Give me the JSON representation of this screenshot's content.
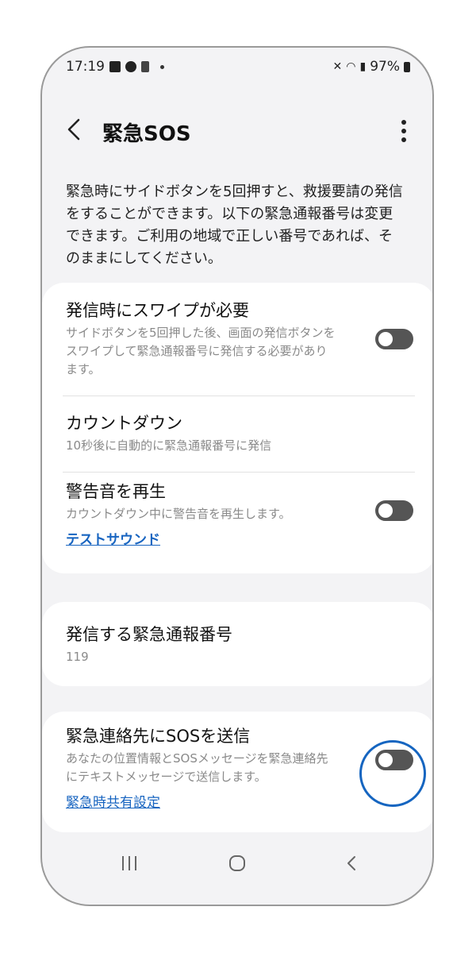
{
  "status_bar": {
    "time": "17:19",
    "battery": "97%",
    "icons": [
      "picture-icon",
      "messenger-icon",
      "notification-icon",
      "dot-icon",
      "mute-icon",
      "wifi-icon",
      "signal-icon",
      "battery-icon"
    ]
  },
  "app_bar": {
    "title": "緊急SOS",
    "back_icon": "chevron-left-icon",
    "more_icon": "more-vertical-icon"
  },
  "description": "緊急時にサイドボタンを5回押すと、救援要請の発信をすることができます。以下の緊急通報番号は変更できます。ご利用の地域で正しい番号であれば、そのままにしてください。",
  "settings": {
    "swipe_to_call": {
      "title": "発信時にスワイプが必要",
      "subtitle": "サイドボタンを5回押した後、画面の発信ボタンをスワイプして緊急通報番号に発信する必要があります。",
      "enabled": false
    },
    "countdown": {
      "title": "カウントダウン",
      "subtitle": "10秒後に自動的に緊急通報番号に発信"
    },
    "warning_sound": {
      "title": "警告音を再生",
      "subtitle": "カウントダウン中に警告音を再生します。",
      "link": "テストサウンド",
      "enabled": false
    },
    "emergency_number": {
      "title": "発信する緊急通報番号",
      "value": "119"
    },
    "send_sos": {
      "title": "緊急連絡先にSOSを送信",
      "subtitle": "あなたの位置情報とSOSメッセージを緊急連絡先にテキストメッセージで送信します。",
      "link": "緊急時共有設定",
      "enabled": false
    }
  },
  "nav_bar": {
    "icons": [
      "recent-apps-icon",
      "home-icon",
      "back-icon"
    ]
  },
  "colors": {
    "accent_link": "#1764c0",
    "highlight_ring": "#1565c0",
    "toggle_off": "#555555"
  }
}
